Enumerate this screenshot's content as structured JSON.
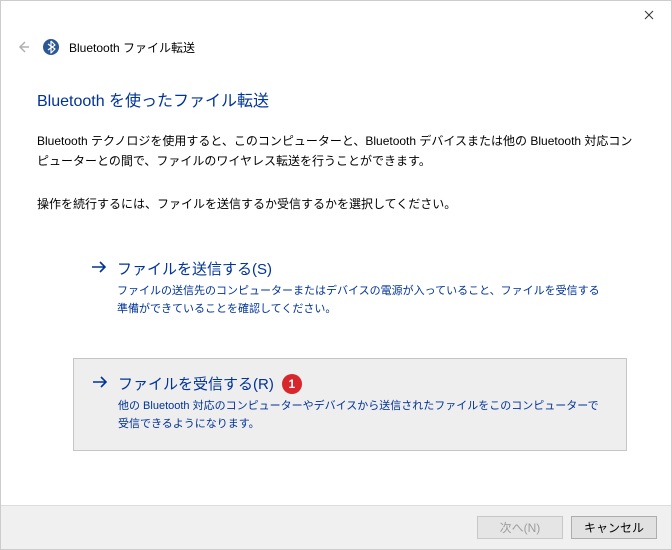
{
  "window": {
    "title": "Bluetooth ファイル転送"
  },
  "page": {
    "heading": "Bluetooth を使ったファイル転送",
    "description": "Bluetooth テクノロジを使用すると、このコンピューターと、Bluetooth デバイスまたは他の Bluetooth 対応コンピューターとの間で、ファイルのワイヤレス転送を行うことができます。",
    "instruction": "操作を続行するには、ファイルを送信するか受信するかを選択してください。"
  },
  "options": {
    "send": {
      "title": "ファイルを送信する(S)",
      "desc": "ファイルの送信先のコンピューターまたはデバイスの電源が入っていること、ファイルを受信する準備ができていることを確認してください。"
    },
    "receive": {
      "title": "ファイルを受信する(R)",
      "desc": "他の Bluetooth 対応のコンピューターやデバイスから送信されたファイルをこのコンピューターで受信できるようになります。",
      "badge": "1"
    }
  },
  "footer": {
    "next": "次へ(N)",
    "cancel": "キャンセル"
  }
}
